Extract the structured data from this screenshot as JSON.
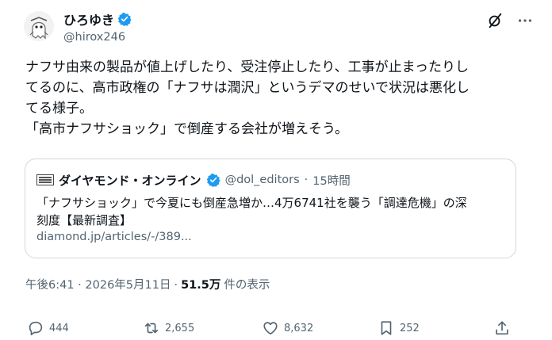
{
  "author": {
    "display_name": "ひろゆき",
    "handle": "@hirox246",
    "avatar_icon": "avatar-ghost-icon"
  },
  "header": {
    "grok_icon": "grok-icon",
    "more_icon": "more-dots-icon"
  },
  "post": {
    "text": "ナフサ由来の製品が値上げしたり、受注停止したり、工事が止まったりし\nてるのに、高市政権の「ナフサは潤沢」というデマのせいで状況は悪化し\nてる様子。\n「高市ナフサショック」で倒産する会社が増えそう。"
  },
  "quote": {
    "name": "ダイヤモンド・オンライン",
    "handle": "@dol_editors",
    "dot": "·",
    "time": "15時間",
    "text": "「ナフサショック」で今夏にも倒産急増か…4万6741社を襲う「調達危機」の深\n刻度【最新調査】",
    "link": "diamond.jp/articles/-/389..."
  },
  "meta": {
    "timestamp": "午後6:41 · 2026年5月11日",
    "sep": "·",
    "views_num": "51.5万",
    "views_label": "件の表示"
  },
  "actions": {
    "replies": "444",
    "reposts": "2,655",
    "likes": "8,632",
    "bookmarks": "252"
  },
  "colors": {
    "verified": "#1d9bf0",
    "secondary_text": "#536471",
    "border": "#cfd9de"
  }
}
